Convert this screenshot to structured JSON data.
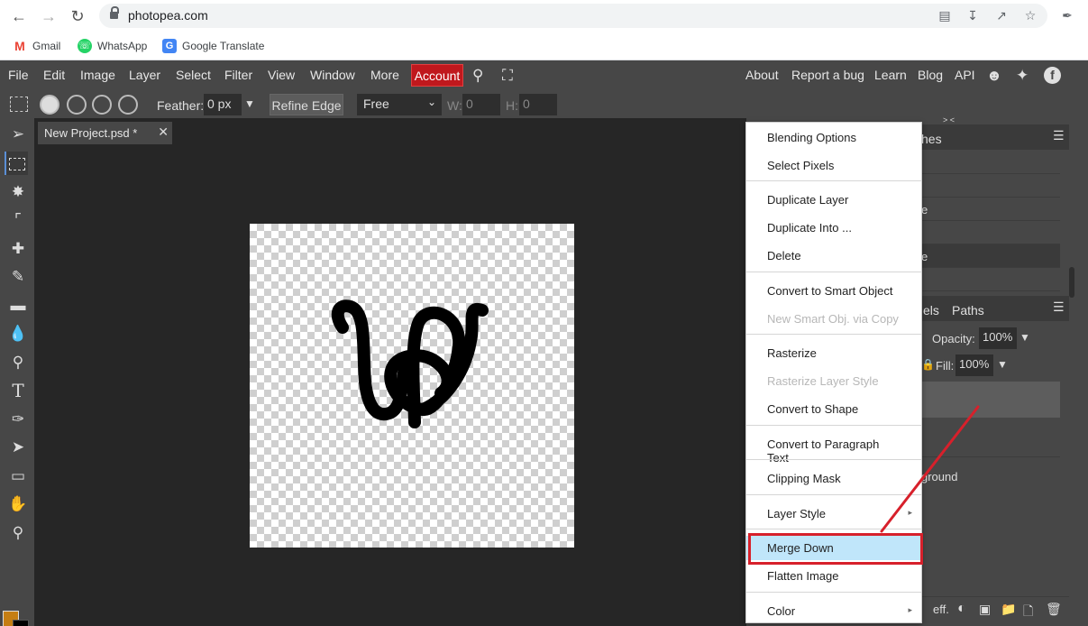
{
  "browser": {
    "url": "photopea.com",
    "bookmarks": [
      {
        "label": "Gmail",
        "icon": "gmail-icon",
        "color": "#ea4335"
      },
      {
        "label": "WhatsApp",
        "icon": "whatsapp-icon",
        "color": "#25d366"
      },
      {
        "label": "Google Translate",
        "icon": "google-translate-icon",
        "color": "#4285f4"
      }
    ]
  },
  "menubar": {
    "items": [
      "File",
      "Edit",
      "Image",
      "Layer",
      "Select",
      "Filter",
      "View",
      "Window",
      "More"
    ],
    "account": "Account",
    "right_links": [
      "About",
      "Report a bug",
      "Learn",
      "Blog",
      "API"
    ]
  },
  "options": {
    "feather_label": "Feather:",
    "feather_value": "0 px",
    "refine_edge": "Refine Edge",
    "mode": "Free",
    "w_label": "W:",
    "w_value": "0",
    "h_label": "H:",
    "h_value": "0"
  },
  "document": {
    "tab_title": "New Project.psd *"
  },
  "panels": {
    "top_tab_partial": "hes",
    "collapse_mark": "> <",
    "rows_top": [
      "",
      "",
      "e",
      "",
      "e"
    ],
    "second_tabs_partial": [
      "els",
      "Paths"
    ],
    "opacity_label": "Opacity:",
    "opacity_value": "100%",
    "fill_label": "Fill:",
    "fill_value": "100%",
    "layer_partial": "ground",
    "bottom_label": "eff."
  },
  "context_menu": {
    "items": [
      {
        "label": "Blending Options",
        "enabled": true
      },
      {
        "label": "Select Pixels",
        "enabled": true
      },
      {
        "label": "Duplicate Layer",
        "enabled": true
      },
      {
        "label": "Duplicate Into ...",
        "enabled": true
      },
      {
        "label": "Delete",
        "enabled": true
      },
      {
        "label": "Convert to Smart Object",
        "enabled": true
      },
      {
        "label": "New Smart Obj. via Copy",
        "enabled": false
      },
      {
        "label": "Rasterize",
        "enabled": true
      },
      {
        "label": "Rasterize Layer Style",
        "enabled": false
      },
      {
        "label": "Convert to Shape",
        "enabled": true
      },
      {
        "label": "Convert to Paragraph Text",
        "enabled": true
      },
      {
        "label": "Clipping Mask",
        "enabled": true
      },
      {
        "label": "Layer Style",
        "enabled": true,
        "submenu": true
      },
      {
        "label": "Merge Down",
        "enabled": true,
        "highlighted": true
      },
      {
        "label": "Flatten Image",
        "enabled": true
      },
      {
        "label": "Color",
        "enabled": true,
        "submenu": true
      }
    ]
  },
  "colors": {
    "foreground": "#c57e13",
    "background": "#000000",
    "accent_red": "#d7202b"
  }
}
